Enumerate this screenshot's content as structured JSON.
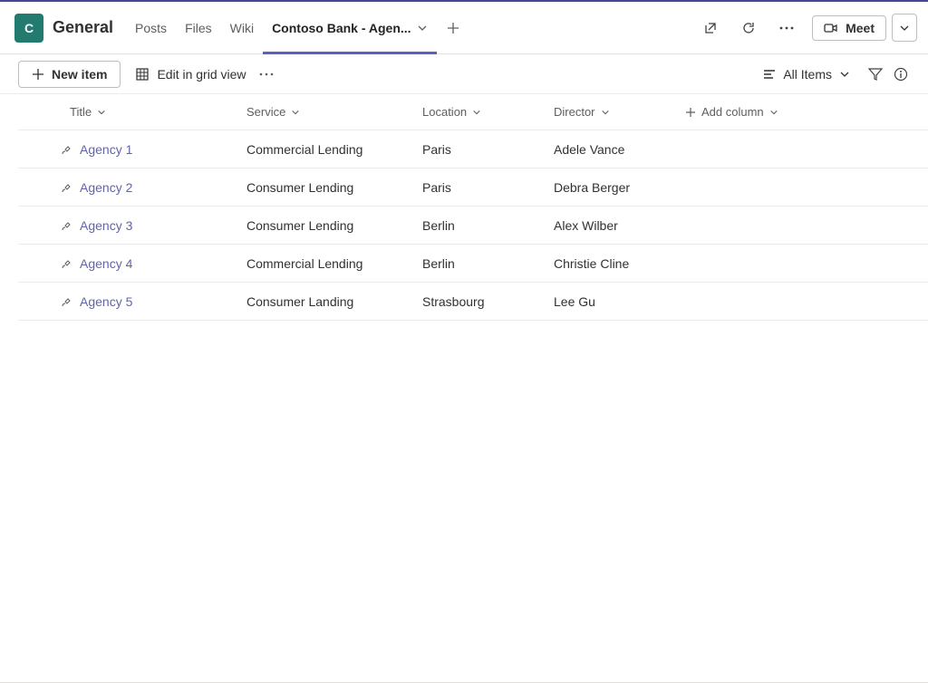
{
  "team": {
    "avatar_letter": "C",
    "channel_name": "General"
  },
  "tabs": {
    "items": [
      {
        "label": "Posts"
      },
      {
        "label": "Files"
      },
      {
        "label": "Wiki"
      },
      {
        "label": "Contoso Bank - Agen..."
      }
    ]
  },
  "header_actions": {
    "meet_label": "Meet"
  },
  "cmdbar": {
    "new_item_label": "New item",
    "grid_view_label": "Edit in grid view",
    "view_label": "All Items"
  },
  "columns": {
    "title": "Title",
    "service": "Service",
    "location": "Location",
    "director": "Director",
    "add_column": "Add column"
  },
  "rows": [
    {
      "title": "Agency 1",
      "service": "Commercial Lending",
      "location": "Paris",
      "director": "Adele Vance"
    },
    {
      "title": "Agency 2",
      "service": "Consumer Lending",
      "location": "Paris",
      "director": "Debra Berger"
    },
    {
      "title": "Agency 3",
      "service": "Consumer Lending",
      "location": "Berlin",
      "director": "Alex Wilber"
    },
    {
      "title": "Agency 4",
      "service": "Commercial Lending",
      "location": "Berlin",
      "director": "Christie Cline"
    },
    {
      "title": "Agency 5",
      "service": "Consumer Landing",
      "location": "Strasbourg",
      "director": "Lee Gu"
    }
  ]
}
